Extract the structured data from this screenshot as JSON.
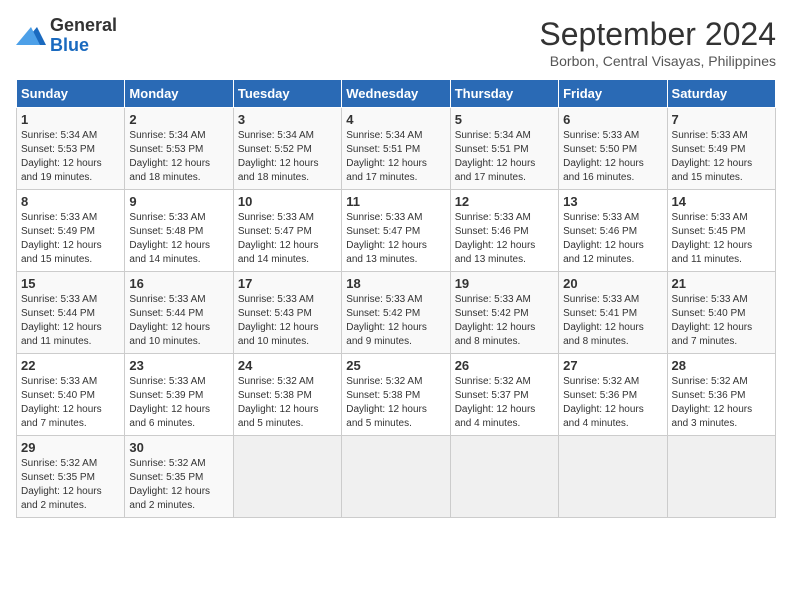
{
  "header": {
    "logo_general": "General",
    "logo_blue": "Blue",
    "month_year": "September 2024",
    "location": "Borbon, Central Visayas, Philippines"
  },
  "weekdays": [
    "Sunday",
    "Monday",
    "Tuesday",
    "Wednesday",
    "Thursday",
    "Friday",
    "Saturday"
  ],
  "weeks": [
    [
      {
        "day": "1",
        "sunrise": "5:34 AM",
        "sunset": "5:53 PM",
        "daylight": "12 hours and 19 minutes."
      },
      {
        "day": "2",
        "sunrise": "5:34 AM",
        "sunset": "5:53 PM",
        "daylight": "12 hours and 18 minutes."
      },
      {
        "day": "3",
        "sunrise": "5:34 AM",
        "sunset": "5:52 PM",
        "daylight": "12 hours and 18 minutes."
      },
      {
        "day": "4",
        "sunrise": "5:34 AM",
        "sunset": "5:51 PM",
        "daylight": "12 hours and 17 minutes."
      },
      {
        "day": "5",
        "sunrise": "5:34 AM",
        "sunset": "5:51 PM",
        "daylight": "12 hours and 17 minutes."
      },
      {
        "day": "6",
        "sunrise": "5:33 AM",
        "sunset": "5:50 PM",
        "daylight": "12 hours and 16 minutes."
      },
      {
        "day": "7",
        "sunrise": "5:33 AM",
        "sunset": "5:49 PM",
        "daylight": "12 hours and 15 minutes."
      }
    ],
    [
      {
        "day": "8",
        "sunrise": "5:33 AM",
        "sunset": "5:49 PM",
        "daylight": "12 hours and 15 minutes."
      },
      {
        "day": "9",
        "sunrise": "5:33 AM",
        "sunset": "5:48 PM",
        "daylight": "12 hours and 14 minutes."
      },
      {
        "day": "10",
        "sunrise": "5:33 AM",
        "sunset": "5:47 PM",
        "daylight": "12 hours and 14 minutes."
      },
      {
        "day": "11",
        "sunrise": "5:33 AM",
        "sunset": "5:47 PM",
        "daylight": "12 hours and 13 minutes."
      },
      {
        "day": "12",
        "sunrise": "5:33 AM",
        "sunset": "5:46 PM",
        "daylight": "12 hours and 13 minutes."
      },
      {
        "day": "13",
        "sunrise": "5:33 AM",
        "sunset": "5:46 PM",
        "daylight": "12 hours and 12 minutes."
      },
      {
        "day": "14",
        "sunrise": "5:33 AM",
        "sunset": "5:45 PM",
        "daylight": "12 hours and 11 minutes."
      }
    ],
    [
      {
        "day": "15",
        "sunrise": "5:33 AM",
        "sunset": "5:44 PM",
        "daylight": "12 hours and 11 minutes."
      },
      {
        "day": "16",
        "sunrise": "5:33 AM",
        "sunset": "5:44 PM",
        "daylight": "12 hours and 10 minutes."
      },
      {
        "day": "17",
        "sunrise": "5:33 AM",
        "sunset": "5:43 PM",
        "daylight": "12 hours and 10 minutes."
      },
      {
        "day": "18",
        "sunrise": "5:33 AM",
        "sunset": "5:42 PM",
        "daylight": "12 hours and 9 minutes."
      },
      {
        "day": "19",
        "sunrise": "5:33 AM",
        "sunset": "5:42 PM",
        "daylight": "12 hours and 8 minutes."
      },
      {
        "day": "20",
        "sunrise": "5:33 AM",
        "sunset": "5:41 PM",
        "daylight": "12 hours and 8 minutes."
      },
      {
        "day": "21",
        "sunrise": "5:33 AM",
        "sunset": "5:40 PM",
        "daylight": "12 hours and 7 minutes."
      }
    ],
    [
      {
        "day": "22",
        "sunrise": "5:33 AM",
        "sunset": "5:40 PM",
        "daylight": "12 hours and 7 minutes."
      },
      {
        "day": "23",
        "sunrise": "5:33 AM",
        "sunset": "5:39 PM",
        "daylight": "12 hours and 6 minutes."
      },
      {
        "day": "24",
        "sunrise": "5:32 AM",
        "sunset": "5:38 PM",
        "daylight": "12 hours and 5 minutes."
      },
      {
        "day": "25",
        "sunrise": "5:32 AM",
        "sunset": "5:38 PM",
        "daylight": "12 hours and 5 minutes."
      },
      {
        "day": "26",
        "sunrise": "5:32 AM",
        "sunset": "5:37 PM",
        "daylight": "12 hours and 4 minutes."
      },
      {
        "day": "27",
        "sunrise": "5:32 AM",
        "sunset": "5:36 PM",
        "daylight": "12 hours and 4 minutes."
      },
      {
        "day": "28",
        "sunrise": "5:32 AM",
        "sunset": "5:36 PM",
        "daylight": "12 hours and 3 minutes."
      }
    ],
    [
      {
        "day": "29",
        "sunrise": "5:32 AM",
        "sunset": "5:35 PM",
        "daylight": "12 hours and 2 minutes."
      },
      {
        "day": "30",
        "sunrise": "5:32 AM",
        "sunset": "5:35 PM",
        "daylight": "12 hours and 2 minutes."
      },
      null,
      null,
      null,
      null,
      null
    ]
  ]
}
